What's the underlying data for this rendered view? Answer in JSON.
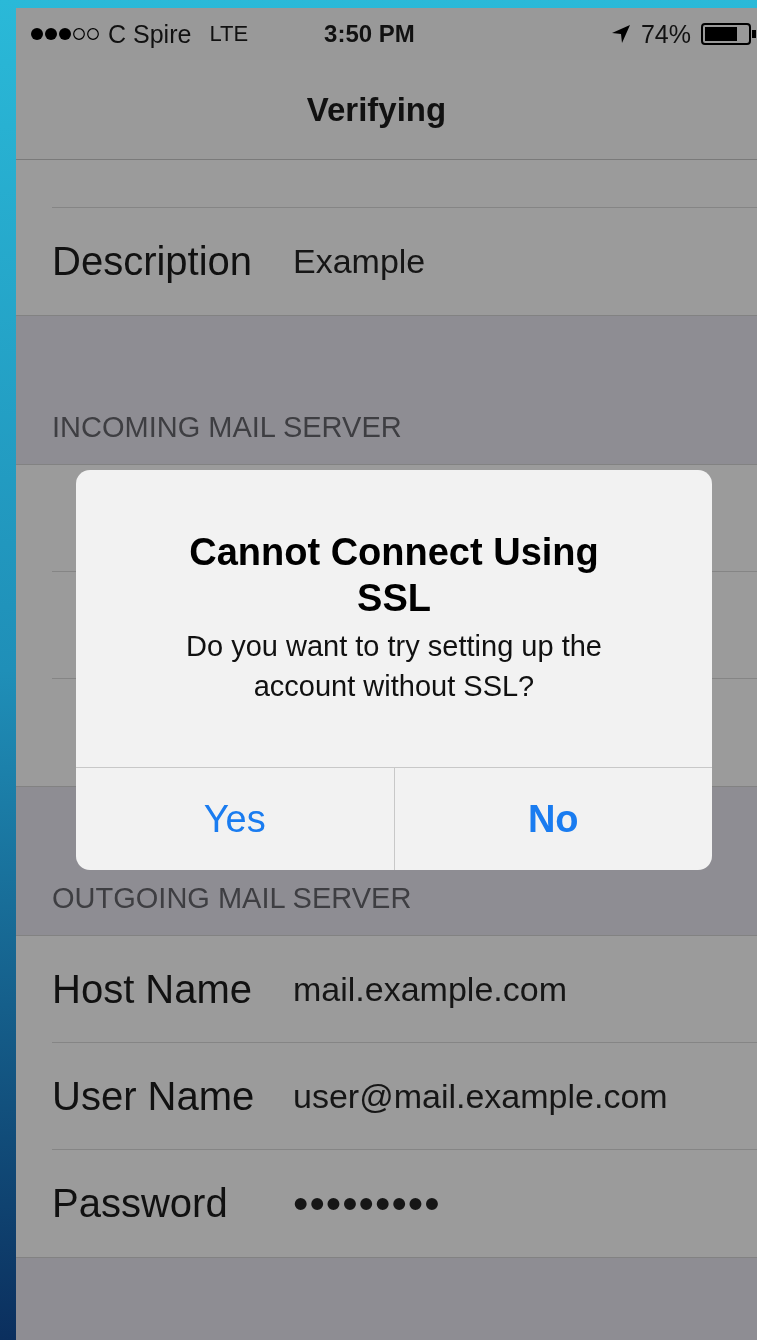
{
  "status_bar": {
    "carrier": "C Spire",
    "network": "LTE",
    "time": "3:50 PM",
    "battery": "74%"
  },
  "nav": {
    "title": "Verifying"
  },
  "sections": [
    {
      "rows": [
        {
          "label": "Description",
          "value": "Example",
          "kind": "text"
        }
      ]
    },
    {
      "header": "INCOMING MAIL SERVER"
    },
    {
      "header": "OUTGOING MAIL SERVER",
      "rows": [
        {
          "label": "Host Name",
          "value": "mail.example.com",
          "kind": "text"
        },
        {
          "label": "User Name",
          "value": "user@mail.example.com",
          "kind": "text"
        },
        {
          "label": "Password",
          "value": "•••••••••",
          "kind": "secure"
        }
      ]
    }
  ],
  "alert": {
    "title": "Cannot Connect Using SSL",
    "message": "Do you want to try setting up the account without SSL?",
    "buttons": [
      {
        "label": "Yes",
        "preferred": false
      },
      {
        "label": "No",
        "preferred": true
      }
    ]
  }
}
